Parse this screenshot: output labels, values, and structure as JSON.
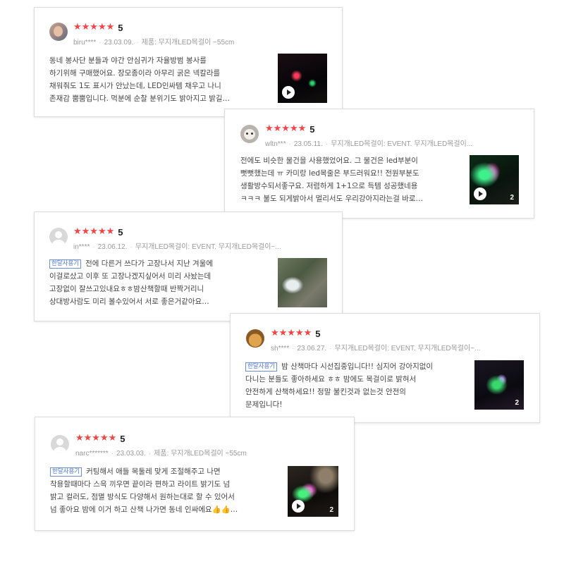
{
  "reviews": [
    {
      "user": "biru****",
      "rating": "5",
      "stars": "★★★★★",
      "date": "23.03.09.",
      "product": "제품: 무지개LED목걸이 ~55cm",
      "badge": "",
      "lines": [
        "동네 봉사단 분들과 야간 안심귀가 자율방범 봉사를",
        "하기위해 구매했어요. 장모종이라 아무리 굵은 넥칼라를",
        "채워줘도 1도 표시가 안났는데, LED인싸템 채우고 나니",
        "존재감 뿜뿜입니다. 먹분에 순찰 분위기도 밝아지고 밝길…"
      ],
      "media": {
        "type": "video",
        "count": ""
      }
    },
    {
      "user": "wltn***",
      "rating": "5",
      "stars": "★★★★★",
      "date": "23.05.11.",
      "product": "무지개LED목걸이: EVENT. 무지개LED목걸이...",
      "badge": "",
      "lines": [
        "전에도 비슷한 물건을 사용했었어요. 그 물건은 led부분이",
        "뻣뻣했는데 ㅠ 카미랑 led목줄은 부드러워요!! 전원부분도",
        "생활방수되서좋구요. 저렴하게 1+1으로 득템 성공했네용",
        "ㅋㅋㅋ 불도 되게밝아서 멀리서도 우리강아지라는걸 바로…"
      ],
      "media": {
        "type": "video",
        "count": "2"
      }
    },
    {
      "user": "in****",
      "rating": "5",
      "stars": "★★★★★",
      "date": "23.06.12.",
      "product": "무지개LED목걸이: EVENT. 무지개LED목걸이~...",
      "badge": "한달사용기",
      "lines": [
        "전에 다른거 쓰다가 고장나서 지난 겨울에",
        "이걸로샀고 이후 또 고장나겠지싶어서 미리 사놨는데",
        "고장없이 잘쓰고있내요ㅎㅎ밤산책할때 반짝거리니",
        "상대방사람도 미리 볼수있어서 서로 좋은거같아요…"
      ],
      "media": {
        "type": "photo",
        "count": ""
      }
    },
    {
      "user": "sh****",
      "rating": "5",
      "stars": "★★★★★",
      "date": "23.06.27.",
      "product": "무지개LED목걸이: EVENT. 무지개LED목걸이~...",
      "badge": "한달사용기",
      "lines": [
        "밤 산책마다 시선집중입니다!! 심지어 강아지없이",
        "다니는 분들도 좋아하세요 ㅎㅎ 밤에도 목걸이로 밝혀서",
        "안전하게 산책하세요!! 정말 불킨것과 없는것 안전의",
        "문제입니다!"
      ],
      "media": {
        "type": "photo",
        "count": "2"
      }
    },
    {
      "user": "narc*******",
      "rating": "5",
      "stars": "★★★★★",
      "date": "23.03.03.",
      "product": "제품: 무지개LED목걸이 ~55cm",
      "badge": "한달사용기",
      "lines": [
        "커팅해서 애들 목둘레 맞게 조절해주고 나면",
        "착용할때마다 스윽 끼우면 끝이라 편하고 라이트 밝기도 넘",
        "밝고 컬러도, 점멸 방식도 다양해서 원하는대로 할 수 있어서",
        "넘 좋아요 밤에 이거 하고 산책 나가면 동네 인싸에요👍👍…"
      ],
      "media": {
        "type": "video",
        "count": "2"
      }
    }
  ],
  "colors": {
    "star": "#f34545",
    "badge": "#4c73c7"
  },
  "icons": {
    "play": "play-icon",
    "avatar_default": "default-avatar-icon"
  }
}
